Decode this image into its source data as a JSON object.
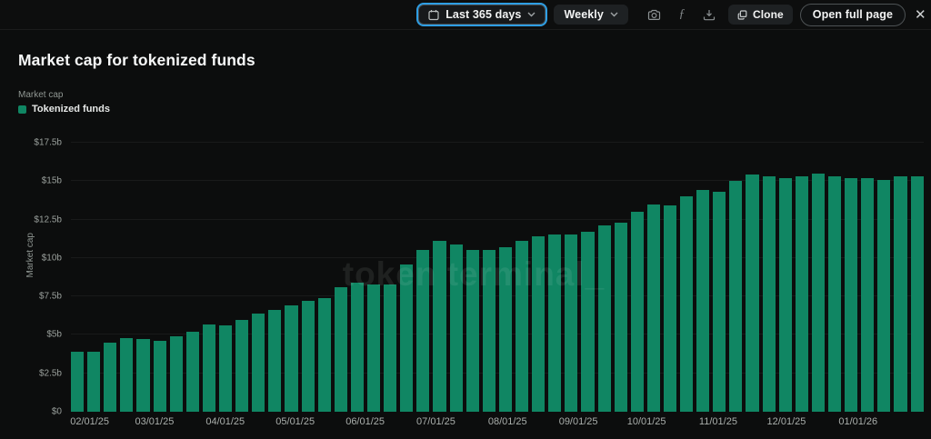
{
  "toolbar": {
    "range_label": "Last 365 days",
    "granularity_label": "Weekly",
    "clone_label": "Clone",
    "open_full_page_label": "Open full page",
    "function_glyph": "ƒ",
    "close_glyph": "✕",
    "icon_names": [
      "calendar-icon",
      "chevron-down-icon",
      "camera-icon",
      "function-icon",
      "download-icon",
      "copy-icon",
      "close-icon"
    ],
    "focus_ring_color": "#2e9ee4"
  },
  "header": {
    "title": "Market cap for tokenized funds"
  },
  "legend": {
    "group_label": "Market cap",
    "series_label": "Tokenized funds",
    "swatch_color": "#108663"
  },
  "watermark": "token terminal_",
  "colors": {
    "background": "#0c0d0d",
    "topbar_background": "#0d0e0e",
    "bar_green": "#108663",
    "grid_line": "rgba(255,255,255,0.055)",
    "axis_text": "#9aa09c"
  },
  "chart_data": {
    "type": "bar",
    "title": "Market cap for tokenized funds",
    "xlabel": "",
    "ylabel": "Market cap",
    "unit": "USD billions",
    "grid": true,
    "legend_position": "top-left",
    "bar_color": "#108663",
    "ylim": [
      0,
      18.5
    ],
    "y_ticks": [
      "$0",
      "$2.5b",
      "$5b",
      "$7.5b",
      "$10b",
      "$12.5b",
      "$15b",
      "$17.5b"
    ],
    "y_tick_values": [
      0,
      2.5,
      5,
      7.5,
      10,
      12.5,
      15,
      17.5
    ],
    "x_tick_labels": [
      "02/01/25",
      "03/01/25",
      "04/01/25",
      "05/01/25",
      "06/01/25",
      "07/01/25",
      "08/01/25",
      "09/01/25",
      "10/01/25",
      "11/01/25",
      "12/01/25",
      "01/01/26"
    ],
    "x_tick_fractions": [
      0.022,
      0.098,
      0.181,
      0.263,
      0.345,
      0.428,
      0.512,
      0.595,
      0.675,
      0.759,
      0.839,
      0.923
    ],
    "series_name": "Tokenized funds",
    "values_unit": "$b",
    "values": [
      3.9,
      3.9,
      4.5,
      4.8,
      4.7,
      4.6,
      4.9,
      5.2,
      5.7,
      5.6,
      6.0,
      6.4,
      6.6,
      6.9,
      7.2,
      7.4,
      8.1,
      8.4,
      8.3,
      8.3,
      9.6,
      10.5,
      11.1,
      10.9,
      10.5,
      10.5,
      10.7,
      11.1,
      11.4,
      11.5,
      11.5,
      11.7,
      12.1,
      12.3,
      13.0,
      13.5,
      13.4,
      14.0,
      14.4,
      14.3,
      15.0,
      15.4,
      15.3,
      15.2,
      15.3,
      15.5,
      15.3,
      15.2,
      15.2,
      15.1,
      15.3,
      15.3
    ]
  }
}
